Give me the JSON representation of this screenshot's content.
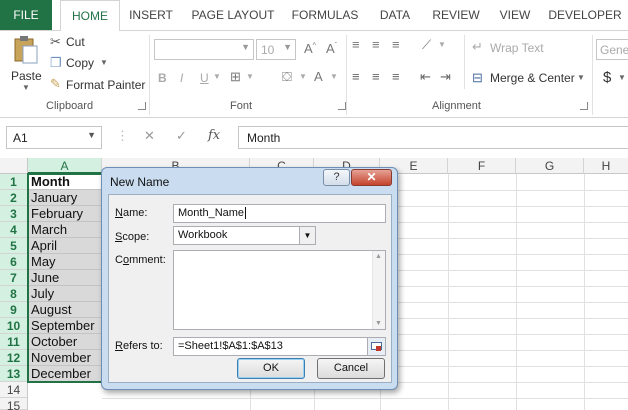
{
  "ribbon_tabs": [
    "FILE",
    "HOME",
    "INSERT",
    "PAGE LAYOUT",
    "FORMULAS",
    "DATA",
    "REVIEW",
    "VIEW",
    "DEVELOPER"
  ],
  "clipboard": {
    "paste": "Paste",
    "cut": "Cut",
    "copy": "Copy",
    "format_painter": "Format Painter",
    "label": "Clipboard"
  },
  "font": {
    "size": "10",
    "label": "Font",
    "bold": "B",
    "italic": "I",
    "underline": "U"
  },
  "alignment": {
    "wrap_text": "Wrap Text",
    "merge_center": "Merge & Center",
    "label": "Alignment"
  },
  "number": {
    "format": "Gene",
    "currency": "$"
  },
  "formula_bar": {
    "name_box": "A1",
    "content": "Month"
  },
  "columns": [
    "A",
    "B",
    "C",
    "D",
    "E",
    "F",
    "G",
    "H"
  ],
  "rows": [
    "1",
    "2",
    "3",
    "4",
    "5",
    "6",
    "7",
    "8",
    "9",
    "10",
    "11",
    "12",
    "13",
    "14",
    "15"
  ],
  "column_a": [
    "Month",
    "January",
    "February",
    "March",
    "April",
    "May",
    "June",
    "July",
    "August",
    "September",
    "October",
    "November",
    "December"
  ],
  "dialog": {
    "title": "New Name",
    "help": "?",
    "close": "✕",
    "name_label_ul": "N",
    "name_label_rest": "ame:",
    "name_value": "Month_Name",
    "scope_label_ul": "S",
    "scope_label_rest": "cope:",
    "scope_value": "Workbook",
    "comment_label_pre": "C",
    "comment_label_ul": "o",
    "comment_label_rest": "mment:",
    "refers_label_ul": "R",
    "refers_label_rest": "efers to:",
    "refers_value": "=Sheet1!$A$1:$A$13",
    "ok": "OK",
    "cancel": "Cancel"
  },
  "colors": {
    "accent": "#217346",
    "selection_fill": "#d9d9d9"
  }
}
